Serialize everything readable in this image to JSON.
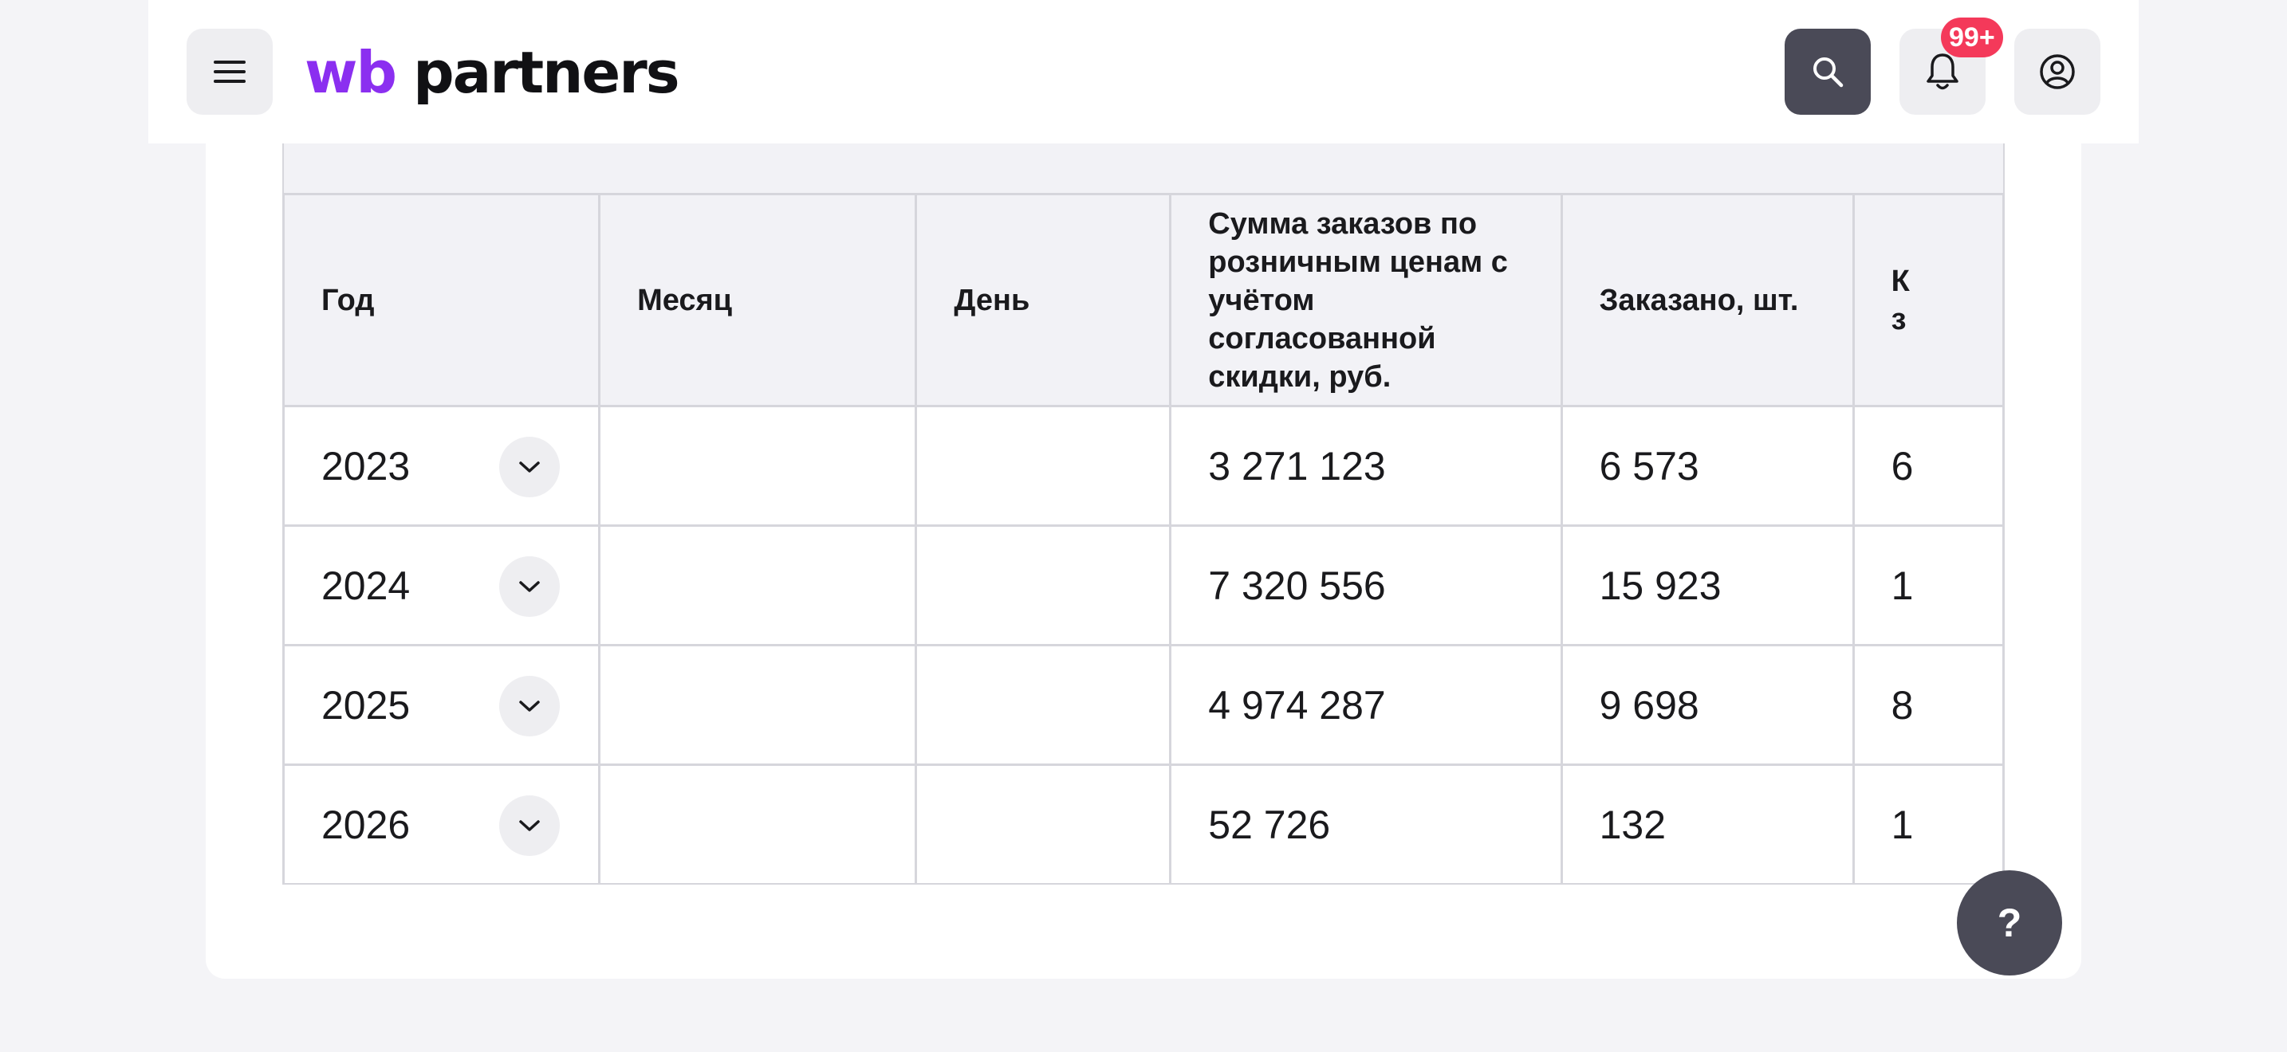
{
  "header": {
    "logo_wb": "wb",
    "logo_partners": "partners",
    "notifications_badge": "99+",
    "icons": [
      "hamburger-menu-icon",
      "search-icon",
      "bell-icon",
      "user-icon"
    ]
  },
  "table": {
    "columns": [
      "Год",
      "Месяц",
      "День",
      "Сумма заказов по розничным ценам с учётом согласованной скидки, руб.",
      "Заказано, шт.",
      "К… з…"
    ],
    "col6_line1": "К",
    "col6_line2": "з",
    "rows": [
      {
        "year": "2023",
        "month": "",
        "day": "",
        "sum": "3 271 123",
        "ordered": "6 573",
        "next": "6"
      },
      {
        "year": "2024",
        "month": "",
        "day": "",
        "sum": "7 320 556",
        "ordered": "15 923",
        "next": "1"
      },
      {
        "year": "2025",
        "month": "",
        "day": "",
        "sum": "4 974 287",
        "ordered": "9 698",
        "next": "8"
      },
      {
        "year": "2026",
        "month": "",
        "day": "",
        "sum": "52 726",
        "ordered": "132",
        "next": "1"
      }
    ]
  },
  "help": {
    "label": "?"
  },
  "colors": {
    "brand_purple": "#8b2ff0",
    "badge_red": "#f4395a",
    "dark_button": "#4a4a57",
    "page_bg": "#f4f4f7"
  }
}
